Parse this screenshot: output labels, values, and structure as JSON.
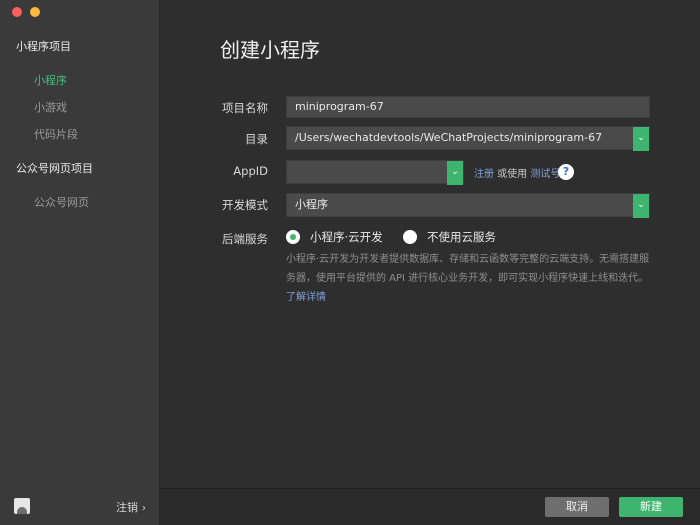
{
  "sidebar": {
    "group1_title": "小程序项目",
    "group1_items": [
      "小程序",
      "小游戏",
      "代码片段"
    ],
    "group2_title": "公众号网页项目",
    "group2_items": [
      "公众号网页"
    ],
    "logout_label": "注销",
    "logout_chevron": "›"
  },
  "main": {
    "title": "创建小程序",
    "project_name_label": "项目名称",
    "project_name_value": "miniprogram-67",
    "directory_label": "目录",
    "directory_value": "/Users/wechatdevtools/WeChatProjects/miniprogram-67",
    "appid_label": "AppID",
    "appid_value": "",
    "register_link": "注册",
    "or_use_text": " 或使用 ",
    "test_account_link": "测试号",
    "help_icon_glyph": "?",
    "dev_mode_label": "开发模式",
    "dev_mode_value": "小程序",
    "backend_label": "后端服务",
    "backend_options": [
      {
        "label": "小程序·云开发",
        "checked": true
      },
      {
        "label": "不使用云服务",
        "checked": false
      }
    ],
    "description": "小程序·云开发为开发者提供数据库、存储和云函数等完整的云端支持。无需搭建服务器，使用平台提供的 API 进行核心业务开发，即可实现小程序快速上线和迭代。",
    "learn_more_link": "了解详情"
  },
  "footer": {
    "cancel_label": "取消",
    "create_label": "新建"
  },
  "dropdown_glyph": "⌄",
  "colors": {
    "accent": "#3fb46e",
    "link": "#7ea0d6",
    "sidebar_bg": "#3a3a3a",
    "main_bg": "#2e2e2e"
  }
}
